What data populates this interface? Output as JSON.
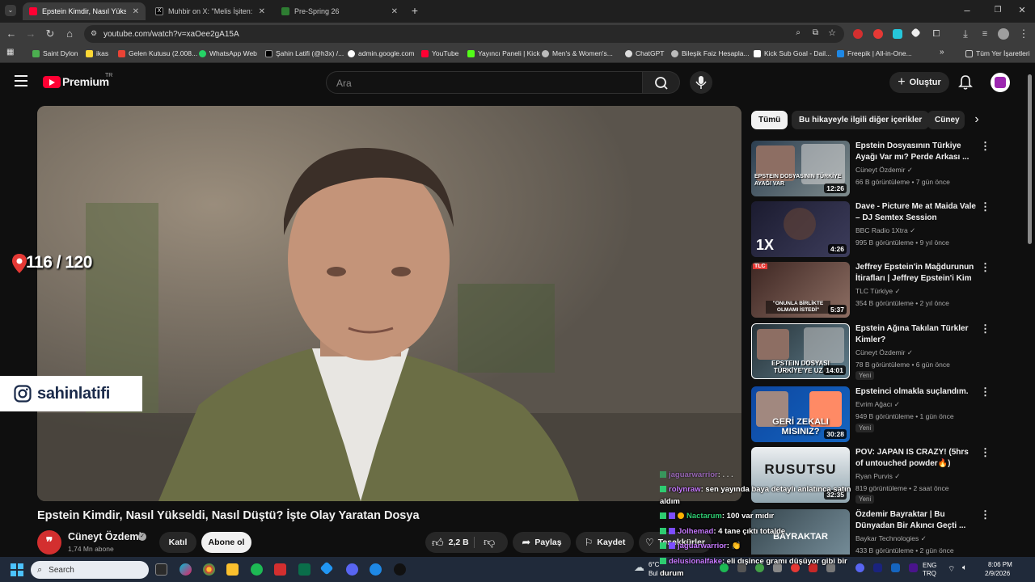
{
  "browser": {
    "tabs": [
      {
        "title": "Epstein Kimdir, Nasıl Yükseldi, N",
        "active": true
      },
      {
        "title": "Muhbir on X: \"Melis İşiten:",
        "active": false
      },
      {
        "title": "Pre-Spring 26",
        "active": false
      }
    ],
    "url": "youtube.com/watch?v=xaOee2gA15A",
    "bookmarks": [
      "Saint Dylon",
      "ikas",
      "Gelen Kutusu (2.008...",
      "WhatsApp Web",
      "Şahin Latifi (@h3x) /...",
      "admin.google.com",
      "YouTube",
      "Yayıncı Paneli | Kick",
      "Men's & Women's...",
      "ChatGPT",
      "Bileşik Faiz Hesapla...",
      "Kick Sub Goal - Dail...",
      "Freepik | All-in-One..."
    ],
    "bookmarks_more": "»",
    "bookmarks_all": "Tüm Yer İşaretleri"
  },
  "youtube": {
    "logo": "Premium",
    "logo_region": "TR",
    "search_placeholder": "Ara",
    "create_label": "Oluştur"
  },
  "video": {
    "overlay_counter": "116 / 120",
    "overlay_handle": "sahinlatifi",
    "title": "Epstein Kimdir, Nasıl Yükseldi, Nasıl Düştü? İşte Olay Yaratan Dosya",
    "channel": "Cüneyt Özdemir",
    "subscribers": "1,74 Mn abone",
    "join_label": "Katıl",
    "subscribe_label": "Abone ol",
    "likes": "2,2 B",
    "share_label": "Paylaş",
    "save_label": "Kaydet",
    "thanks_label": "Teşekkürler"
  },
  "chips": [
    "Tümü",
    "Bu hikayeyle ilgili diğer içerikler",
    "Cüney"
  ],
  "recommendations": [
    {
      "title": "Epstein Dosyasının Türkiye Ayağı Var mı? Perde Arkası ...",
      "channel": "Cüneyt Özdemir",
      "meta": "66 B görüntüleme • 7 gün önce",
      "duration": "12:26",
      "thumb_text": "EPSTEIN DOSYASININ TÜRKİYE AYAĞI VAR",
      "new": ""
    },
    {
      "title": "Dave - Picture Me at Maida Vale – DJ Semtex Session",
      "channel": "BBC Radio 1Xtra",
      "meta": "995 B görüntüleme • 9 yıl önce",
      "duration": "4:26",
      "thumb_text": "1X",
      "new": ""
    },
    {
      "title": "Jeffrey Epstein'in Mağdurunun İtirafları | Jeffrey Epstein'i Kim ...",
      "channel": "TLC Türkiye",
      "meta": "354 B görüntüleme • 2 yıl önce",
      "duration": "5:37",
      "thumb_text": "\"ONUNLA BİRLİKTE OLMAMI İSTEDİ\"",
      "new": ""
    },
    {
      "title": "Epstein Ağına Takılan Türkler Kimler?",
      "channel": "Cüneyt Özdemir",
      "meta": "78 B görüntüleme • 6 gün önce",
      "duration": "14:01",
      "thumb_text": "EPSTEIN DOSYASI TÜRKİYE'YE UZA",
      "new": "Yeni"
    },
    {
      "title": "Epsteinci olmakla suçlandım.",
      "channel": "Evrim Ağacı",
      "meta": "949 B görüntüleme • 1 gün önce",
      "duration": "30:28",
      "thumb_text": "GERİ ZEKALI MISINIZ?",
      "new": "Yeni"
    },
    {
      "title": "POV: JAPAN IS CRAZY! (5hrs of untouched powder🔥)",
      "channel": "Ryan Purvis",
      "meta": "819 görüntüleme • 2 saat önce",
      "duration": "32:35",
      "thumb_text": "RUSUTSU",
      "new": "Yeni"
    },
    {
      "title": "Özdemir Bayraktar | Bu Dünyadan Bir Akıncı Geçti ...",
      "channel": "Baykar Technologies",
      "meta": "433 B görüntüleme • 2 gün önce",
      "duration": "",
      "thumb_text": "BAYRAKTAR",
      "new": ""
    }
  ],
  "chat": [
    {
      "user": "jaguarwarrior",
      "text": ": . . ."
    },
    {
      "user": "rolynraw",
      "text": ": sen yayında baya detaylı anlatınca satın"
    },
    {
      "user": "",
      "text": "aldım"
    },
    {
      "user": "Nactarum",
      "text": ": 100 var mıdır"
    },
    {
      "user": "Jolhemad",
      "text": ": 4 tane çıktı totalde"
    },
    {
      "user": "jaguarwarrior",
      "text": ": 👏"
    },
    {
      "user": "delusionalfake",
      "text": ": eli dışince gramı düşüyor gibi bir"
    },
    {
      "user": "",
      "text": "durum"
    }
  ],
  "taskbar": {
    "search_placeholder": "Search",
    "weather_temp": "6°C",
    "weather_desc": "Bul",
    "lang1": "ENG",
    "lang2": "TRQ",
    "time": "8:06 PM",
    "date": "2/9/2026"
  },
  "colors": {
    "youtube_red": "#ff0033",
    "bg": "#0f0f0f",
    "chat_user": "#c779ff"
  }
}
